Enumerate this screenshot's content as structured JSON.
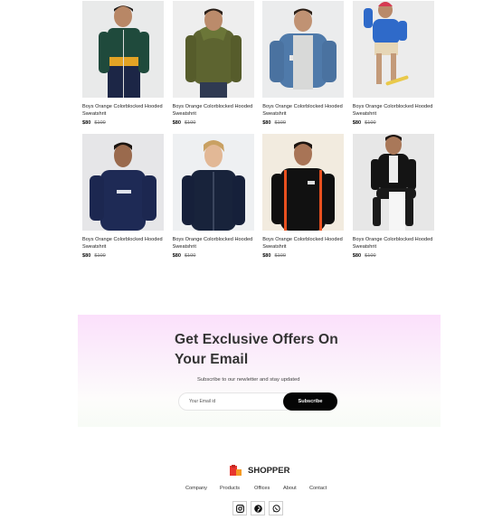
{
  "products": [
    {
      "title": "Boys Orange Colorblocked Hooded Sweatshrit",
      "price": "$80",
      "old_price": "$100",
      "image": "boy-green-track-jacket"
    },
    {
      "title": "Boys Orange Colorblocked Hooded Sweatshrit",
      "price": "$80",
      "old_price": "$100",
      "image": "boy-olive-puffer-jacket"
    },
    {
      "title": "Boys Orange Colorblocked Hooded Sweatshrit",
      "price": "$80",
      "old_price": "$100",
      "image": "boy-denim-jacket"
    },
    {
      "title": "Boys Orange Colorblocked Hooded Sweatshrit",
      "price": "$80",
      "old_price": "$100",
      "image": "boy-blue-hoodie-skateboard"
    },
    {
      "title": "Boys Orange Colorblocked Hooded Sweatshrit",
      "price": "$80",
      "old_price": "$100",
      "image": "boy-navy-sweatshirt"
    },
    {
      "title": "Boys Orange Colorblocked Hooded Sweatshrit",
      "price": "$80",
      "old_price": "$100",
      "image": "boy-navy-zip-jacket"
    },
    {
      "title": "Boys Orange Colorblocked Hooded Sweatshrit",
      "price": "$80",
      "old_price": "$100",
      "image": "boy-black-track-jacket"
    },
    {
      "title": "Boys Orange Colorblocked Hooded Sweatshrit",
      "price": "$80",
      "old_price": "$100",
      "image": "boy-black-jacket-sitting"
    }
  ],
  "newsletter": {
    "title": "Get Exclusive Offers On Your Email",
    "subtitle": "Subscribe to our newletter and stay updated",
    "email_placeholder": "Your Email id",
    "subscribe_label": "Subscribe"
  },
  "footer": {
    "brand": "SHOPPER",
    "nav": [
      "Company",
      "Products",
      "Offices",
      "About",
      "Contact"
    ],
    "socials": [
      "instagram-icon",
      "pinterest-icon",
      "whatsapp-icon"
    ]
  },
  "colors": {
    "accent_dark": "#050505",
    "brand_red": "#e8352e",
    "brand_orange": "#f59a23"
  }
}
